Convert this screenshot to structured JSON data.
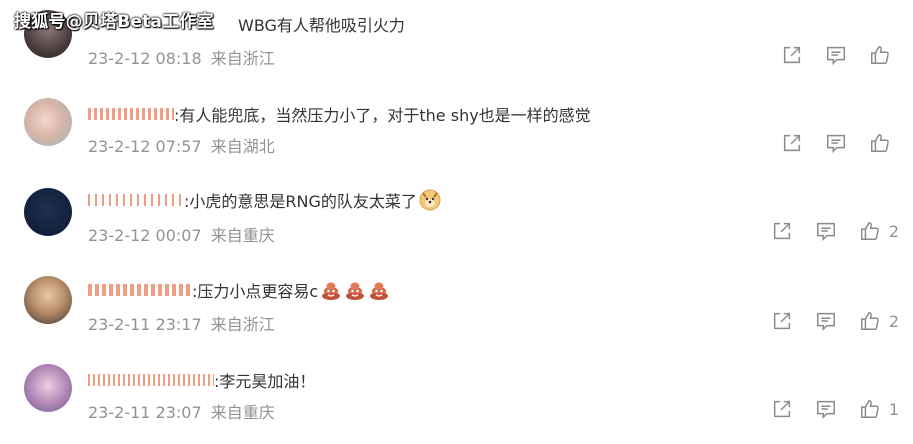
{
  "watermark": "搜狐号@贝塔Beta工作室",
  "colors": {
    "username": "#eb7350",
    "meta": "#939393",
    "text": "#333333",
    "icon": "#8a8a8a"
  },
  "comments": [
    {
      "username": "",
      "text": "WBG有人帮他吸引火力",
      "emojis": [],
      "date": "23-2-12 08:18",
      "location": "来自浙江",
      "likes": ""
    },
    {
      "username": "",
      "text": ":有人能兜底，当然压力小了，对于the shy也是一样的感觉",
      "emojis": [],
      "date": "23-2-12 07:57",
      "location": "来自湖北",
      "likes": ""
    },
    {
      "username": "",
      "text": ":小虎的意思是RNG的队友太菜了",
      "emojis": [
        "doge-emoji"
      ],
      "date": "23-2-12 00:07",
      "location": "来自重庆",
      "likes": "2"
    },
    {
      "username": "",
      "text": ":压力小点更容易c",
      "emojis": [
        "poop-emoji",
        "poop-emoji",
        "poop-emoji"
      ],
      "date": "23-2-11 23:17",
      "location": "来自浙江",
      "likes": "2"
    },
    {
      "username": "",
      "text": ":李元昊加油！",
      "emojis": [],
      "date": "23-2-11 23:07",
      "location": "来自重庆",
      "likes": "1"
    }
  ]
}
